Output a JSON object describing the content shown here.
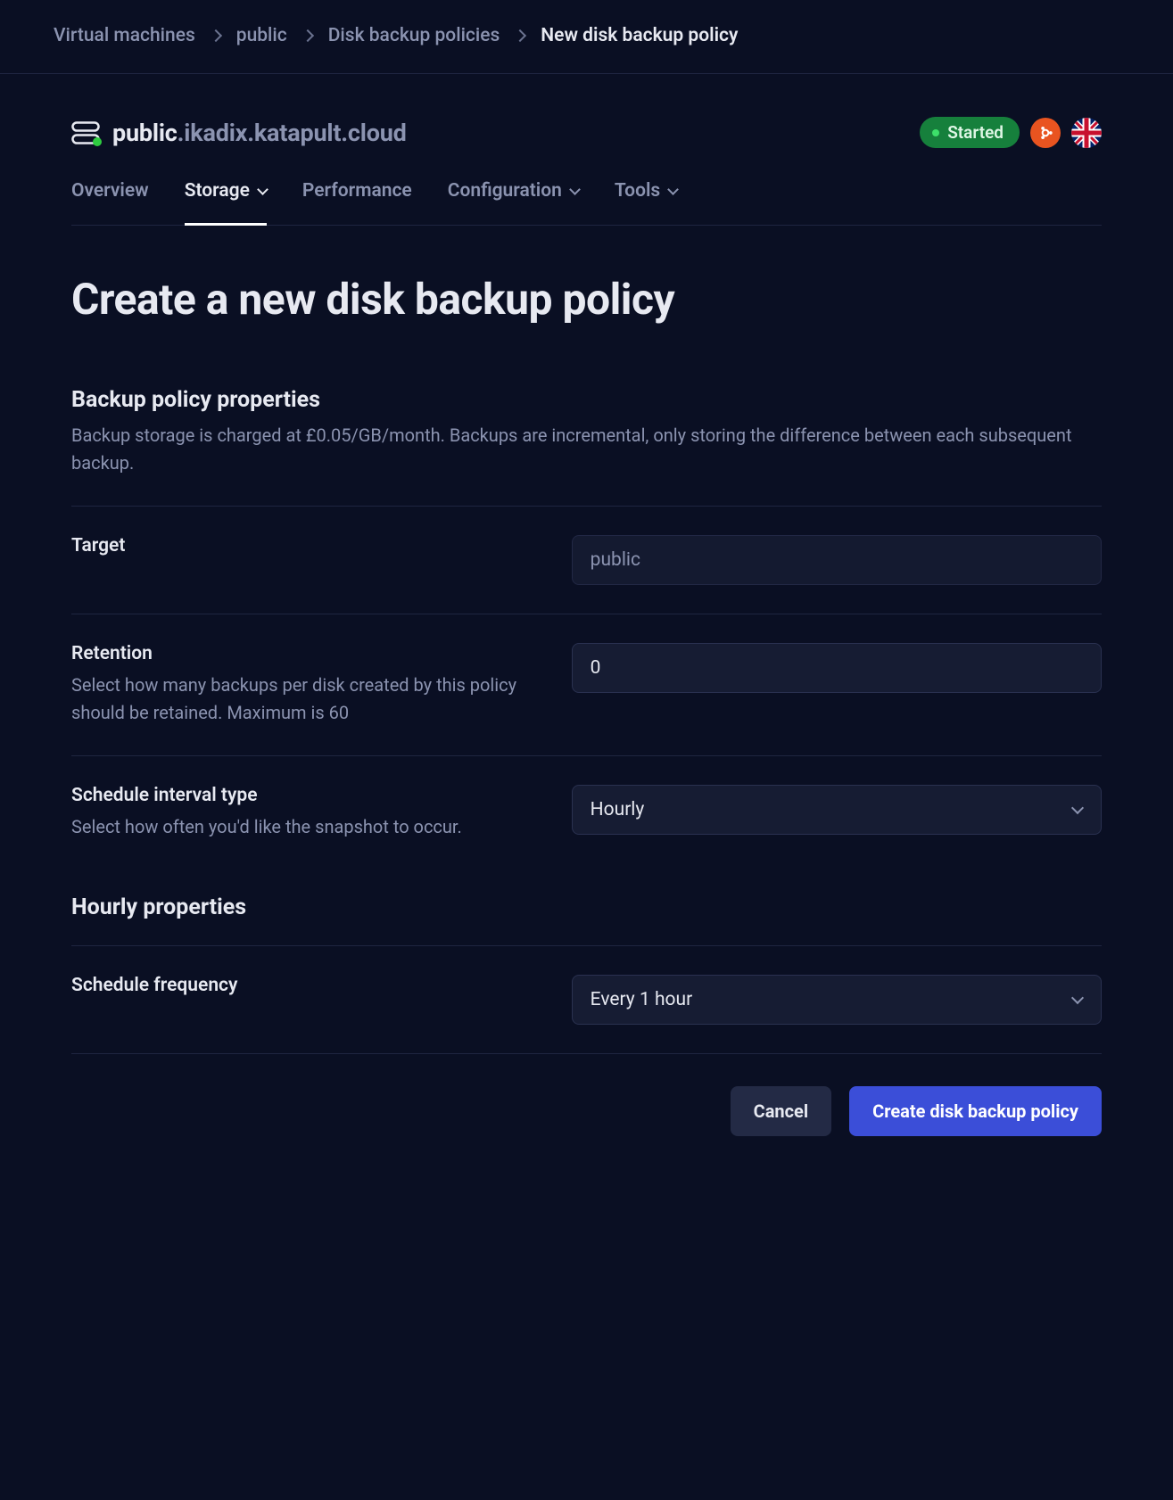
{
  "breadcrumb": {
    "items": [
      "Virtual machines",
      "public",
      "Disk backup policies"
    ],
    "current": "New disk backup policy"
  },
  "vm": {
    "host_primary": "public",
    "host_rest": ".ikadix.katapult.cloud",
    "status": "Started",
    "os": "ubuntu",
    "region": "UK"
  },
  "tabs": {
    "items": [
      {
        "label": "Overview",
        "has_dropdown": false
      },
      {
        "label": "Storage",
        "has_dropdown": true
      },
      {
        "label": "Performance",
        "has_dropdown": false
      },
      {
        "label": "Configuration",
        "has_dropdown": true
      },
      {
        "label": "Tools",
        "has_dropdown": true
      }
    ],
    "active_index": 1
  },
  "page": {
    "title": "Create a new disk backup policy"
  },
  "section_properties": {
    "heading": "Backup policy properties",
    "description": "Backup storage is charged at £0.05/GB/month. Backups are incremental, only storing the difference between each subsequent backup."
  },
  "form": {
    "target": {
      "label": "Target",
      "value": "public"
    },
    "retention": {
      "label": "Retention",
      "help": "Select how many backups per disk created by this policy should be retained. Maximum is 60",
      "value": "0"
    },
    "interval_type": {
      "label": "Schedule interval type",
      "help": "Select how often you'd like the snapshot to occur.",
      "value": "Hourly"
    }
  },
  "section_hourly": {
    "heading": "Hourly properties"
  },
  "form_hourly": {
    "frequency": {
      "label": "Schedule frequency",
      "value": "Every 1 hour"
    }
  },
  "buttons": {
    "cancel": "Cancel",
    "submit": "Create disk backup policy"
  }
}
